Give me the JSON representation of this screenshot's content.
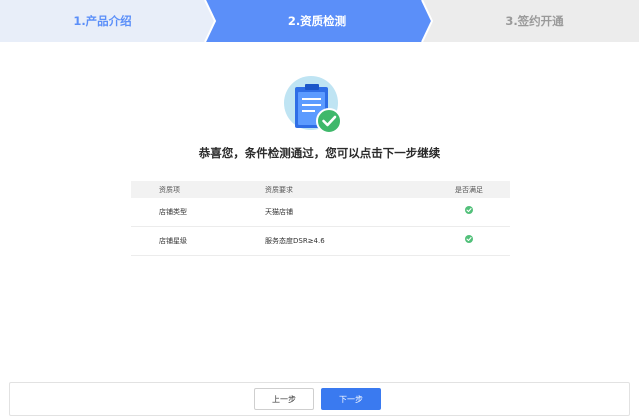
{
  "stepper": {
    "steps": [
      {
        "label": "1.产品介绍",
        "state": "done"
      },
      {
        "label": "2.资质检测",
        "state": "active"
      },
      {
        "label": "3.签约开通",
        "state": "todo"
      }
    ],
    "colors": {
      "active": "#5b8ff9",
      "done_bg": "#e8eef9",
      "todo_bg": "#ececec"
    }
  },
  "illustration": {
    "icon": "clipboard-check-icon"
  },
  "headline": "恭喜您，条件检测通过，您可以点击下一步继续",
  "table": {
    "headers": [
      "资质项",
      "资质要求",
      "是否满足"
    ],
    "rows": [
      {
        "item": "店铺类型",
        "requirement": "天猫店铺",
        "status": "check-icon"
      },
      {
        "item": "店铺星级",
        "requirement": "服务态度DSR≥4.6",
        "status": "check-icon"
      }
    ]
  },
  "footer": {
    "prev_label": "上一步",
    "next_label": "下一步",
    "accent": "#3a7af0"
  }
}
